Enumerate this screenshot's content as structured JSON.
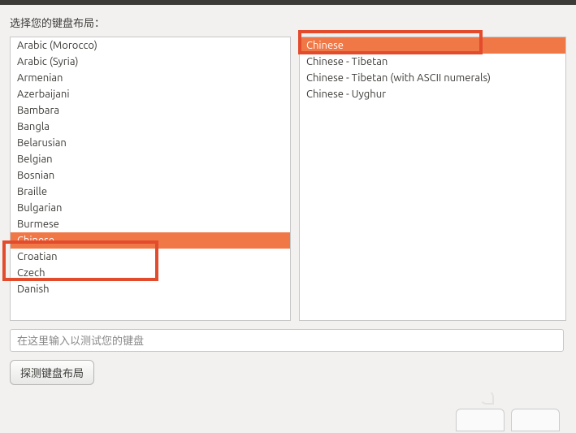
{
  "title": "选择您的键盘布局：",
  "left_list": [
    {
      "label": "Arabic (Morocco)",
      "selected": false
    },
    {
      "label": "Arabic (Syria)",
      "selected": false
    },
    {
      "label": "Armenian",
      "selected": false
    },
    {
      "label": "Azerbaijani",
      "selected": false
    },
    {
      "label": "Bambara",
      "selected": false
    },
    {
      "label": "Bangla",
      "selected": false
    },
    {
      "label": "Belarusian",
      "selected": false
    },
    {
      "label": "Belgian",
      "selected": false
    },
    {
      "label": "Bosnian",
      "selected": false
    },
    {
      "label": "Braille",
      "selected": false
    },
    {
      "label": "Bulgarian",
      "selected": false
    },
    {
      "label": "Burmese",
      "selected": false
    },
    {
      "label": "Chinese",
      "selected": true
    },
    {
      "label": "Croatian",
      "selected": false
    },
    {
      "label": "Czech",
      "selected": false
    },
    {
      "label": "Danish",
      "selected": false
    }
  ],
  "right_list": [
    {
      "label": "Chinese",
      "selected": true
    },
    {
      "label": "Chinese - Tibetan",
      "selected": false
    },
    {
      "label": "Chinese - Tibetan (with ASCII numerals)",
      "selected": false
    },
    {
      "label": "Chinese - Uyghur",
      "selected": false
    }
  ],
  "test_input_placeholder": "在这里输入以测试您的键盘",
  "detect_button_label": "探测键盘布局",
  "colors": {
    "selection": "#f07746",
    "highlight_border": "#e34b2d",
    "background": "#f2f1f0"
  }
}
